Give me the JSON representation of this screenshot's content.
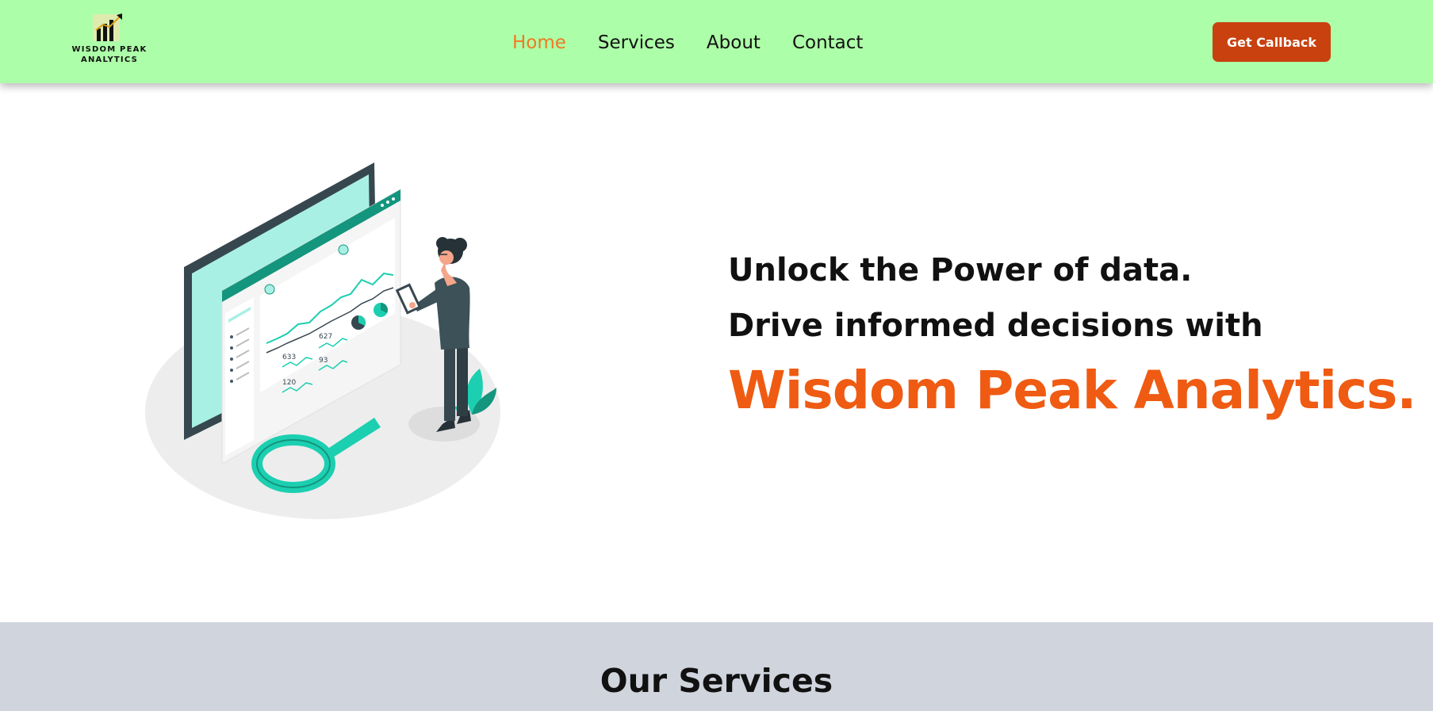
{
  "brand": {
    "logo_line1": "WISDOM PEAK",
    "logo_line2": "ANALYTICS",
    "logo_icon": "bar-chart-arrow-icon"
  },
  "nav": {
    "links": [
      {
        "label": "Home",
        "active": true
      },
      {
        "label": "Services",
        "active": false
      },
      {
        "label": "About",
        "active": false
      },
      {
        "label": "Contact",
        "active": false
      }
    ],
    "cta": "Get Callback"
  },
  "hero": {
    "line1": "Unlock the Power of data.",
    "line2": "Drive informed decisions with",
    "brand_line": "Wisdom Peak Analytics.",
    "illustration": "data-analytics-dashboard-illustration",
    "dashboard_values": [
      "627",
      "633",
      "93",
      "120"
    ]
  },
  "services": {
    "title": "Our Services"
  },
  "colors": {
    "navbar_bg": "#adfea8",
    "accent_orange": "#ef5b12",
    "active_link": "#ef7a22",
    "cta_bg": "#c8410f",
    "teal": "#1ccfb1",
    "dark_slate": "#37474f",
    "services_bg": "#d0d4dd"
  }
}
